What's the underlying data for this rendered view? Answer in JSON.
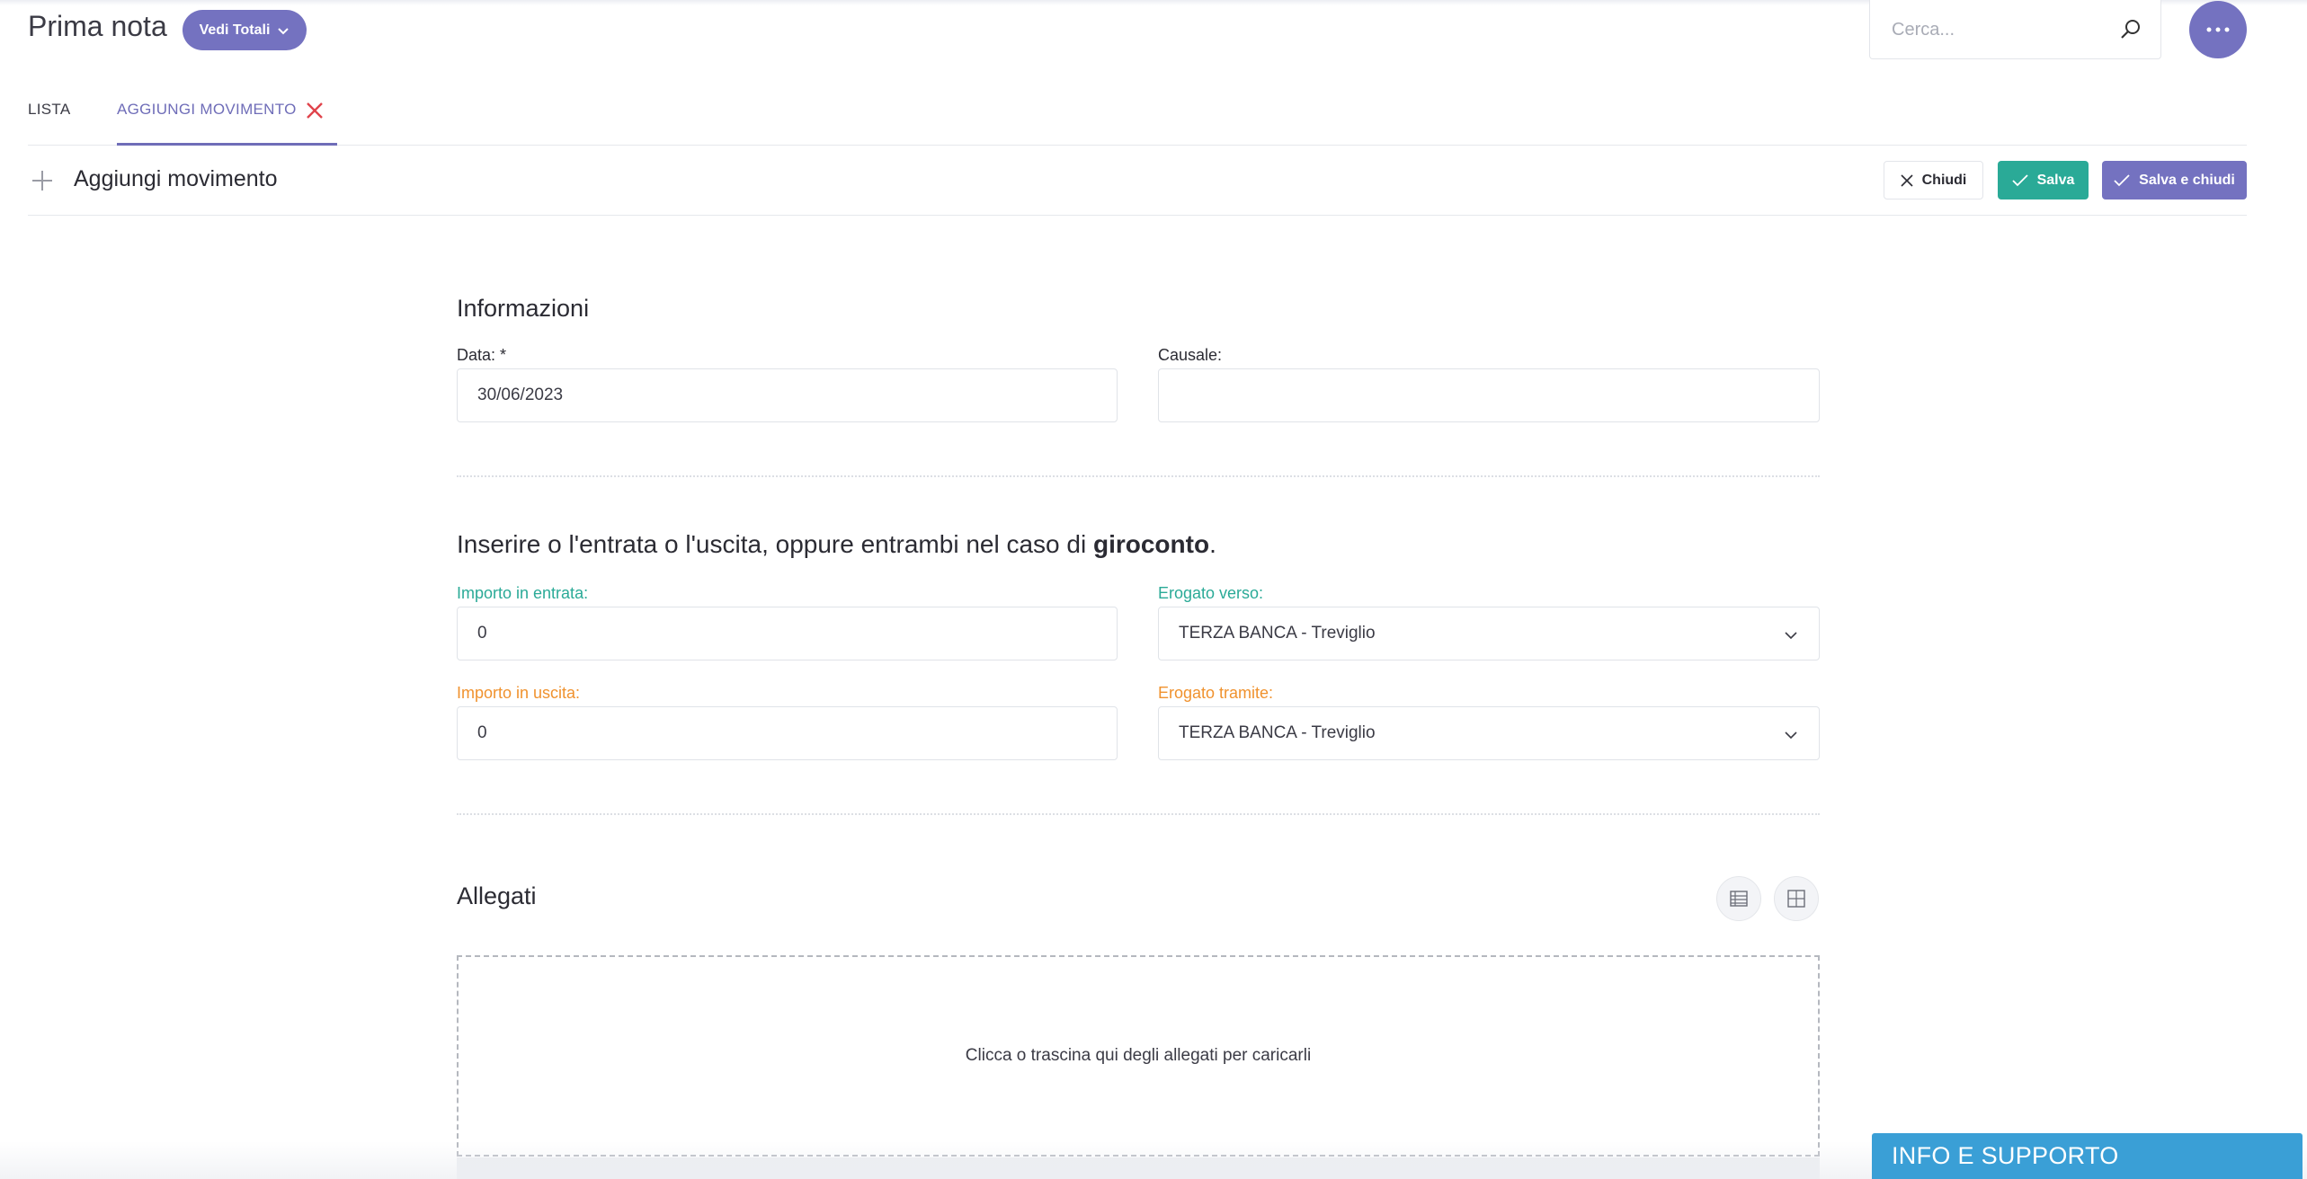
{
  "header": {
    "title": "Prima nota",
    "totals_button": "Vedi Totali",
    "search_placeholder": "Cerca..."
  },
  "tabs": [
    {
      "label": "LISTA"
    },
    {
      "label": "AGGIUNGI MOVIMENTO"
    }
  ],
  "subheader": {
    "title": "Aggiungi movimento",
    "close_label": "Chiudi",
    "save_label": "Salva",
    "save_close_label": "Salva e chiudi"
  },
  "form": {
    "info_title": "Informazioni",
    "data_label": "Data: *",
    "data_value": "30/06/2023",
    "causale_label": "Causale:",
    "causale_value": "",
    "hint_prefix": "Inserire o l'entrata o l'uscita, oppure entrambi nel caso di ",
    "hint_bold": "giroconto",
    "hint_suffix": ".",
    "importo_entrata_label": "Importo in entrata:",
    "importo_entrata_value": "0",
    "erogato_verso_label": "Erogato verso:",
    "erogato_verso_value": "TERZA BANCA - Treviglio",
    "importo_uscita_label": "Importo in uscita:",
    "importo_uscita_value": "0",
    "erogato_tramite_label": "Erogato tramite:",
    "erogato_tramite_value": "TERZA BANCA - Treviglio"
  },
  "attachments": {
    "title": "Allegati",
    "dropzone_text": "Clicca o trascina qui degli allegati per caricarli"
  },
  "support": {
    "label": "INFO E SUPPORTO"
  },
  "colors": {
    "primary": "#7472c0",
    "teal": "#2aaa97",
    "orange": "#f0922e",
    "support_blue": "#3a9fd6",
    "close_red": "#e0434b"
  },
  "icons": [
    "chevron-down-icon",
    "search-icon",
    "more-icon",
    "close-icon",
    "plus-icon",
    "check-icon",
    "list-view-icon",
    "grid-view-icon"
  ]
}
